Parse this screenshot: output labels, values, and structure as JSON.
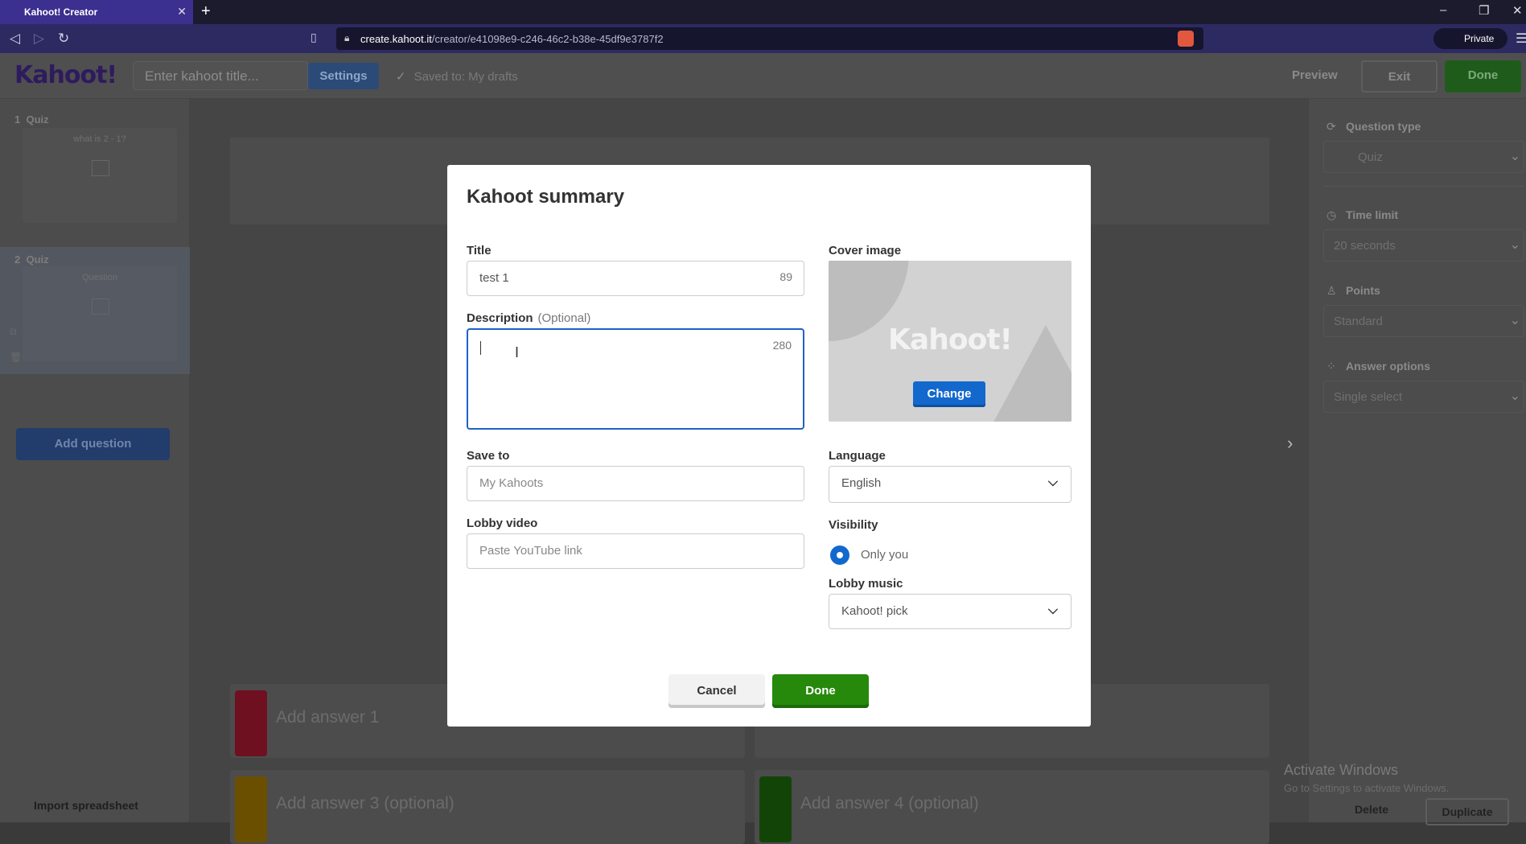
{
  "browser": {
    "tab_title": "Kahoot! Creator",
    "url_host": "create.kahoot.it",
    "url_path": "/creator/e41098e9-c246-46c2-b38e-45df9e3787f2",
    "private_label": "Private"
  },
  "header": {
    "logo": "Kahoot!",
    "title_placeholder": "Enter kahoot title...",
    "settings_label": "Settings",
    "saved_status": "Saved to: My drafts",
    "preview_label": "Preview",
    "exit_label": "Exit",
    "done_label": "Done"
  },
  "sidebar": {
    "questions": [
      {
        "number": "1",
        "type": "Quiz",
        "text": "what is 2 - 1?"
      },
      {
        "number": "2",
        "type": "Quiz",
        "text": "Question"
      }
    ],
    "add_question_label": "Add question",
    "import_label": "Import spreadsheet"
  },
  "answers": [
    {
      "text": "Add answer 1",
      "color": "#e21b3c"
    },
    {
      "text": "Add answer 3 (optional)",
      "color": "#d89e00"
    },
    {
      "text": "Add answer 4 (optional)",
      "color": "#26890c"
    }
  ],
  "right_panel": {
    "question_type_label": "Question type",
    "question_type_value": "Quiz",
    "time_limit_label": "Time limit",
    "time_limit_value": "20 seconds",
    "points_label": "Points",
    "points_value": "Standard",
    "answer_options_label": "Answer options",
    "answer_options_value": "Single select",
    "delete_label": "Delete",
    "duplicate_label": "Duplicate"
  },
  "watermark": {
    "line1": "Activate Windows",
    "line2": "Go to Settings to activate Windows."
  },
  "modal": {
    "heading": "Kahoot summary",
    "title_label": "Title",
    "title_value": "test 1",
    "title_counter": "89",
    "description_label": "Description",
    "description_optional": "(Optional)",
    "description_counter": "280",
    "cover_label": "Cover image",
    "cover_logo": "Kahoot!",
    "change_label": "Change",
    "save_to_label": "Save to",
    "save_to_value": "My Kahoots",
    "language_label": "Language",
    "language_value": "English",
    "lobby_video_label": "Lobby video",
    "lobby_video_placeholder": "Paste YouTube link",
    "visibility_label": "Visibility",
    "visibility_value": "Only you",
    "lobby_music_label": "Lobby music",
    "lobby_music_value": "Kahoot! pick",
    "cancel_label": "Cancel",
    "done_label": "Done"
  },
  "colors": {
    "brand_purple": "#46178f",
    "primary_blue": "#1368ce",
    "done_green": "#26890c"
  }
}
